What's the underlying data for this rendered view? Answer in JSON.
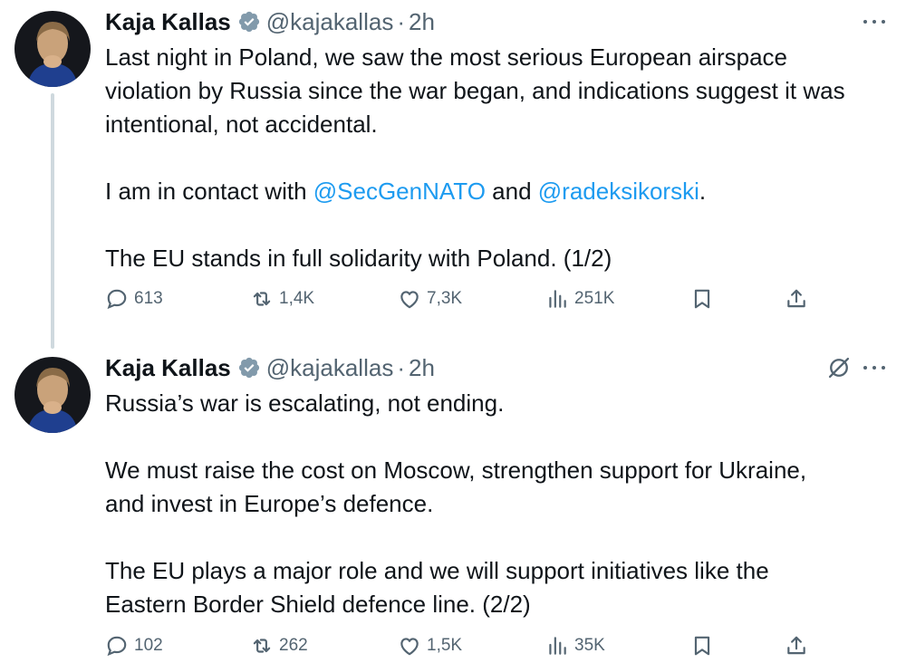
{
  "tweets": [
    {
      "author": {
        "name": "Kaja Kallas",
        "handle": "@kajakallas",
        "time": "2h",
        "verified": true
      },
      "paragraphs": [
        [
          {
            "text": "Last night in Poland, we saw the most serious European airspace"
          },
          {
            "text": "violation by Russia since the war began, and indications suggest it was"
          },
          {
            "text": "intentional, not accidental."
          }
        ],
        [
          {
            "prefix": "I am in contact with ",
            "mention1": "@SecGenNATO",
            "middle": " and ",
            "mention2": "@radeksikorski",
            "suffix": "."
          }
        ],
        [
          {
            "text": "The EU stands in full solidarity with Poland. (1/2)"
          }
        ]
      ],
      "stats": {
        "replies": "613",
        "reposts": "1,4K",
        "likes": "7,3K",
        "views": "251K"
      }
    },
    {
      "author": {
        "name": "Kaja Kallas",
        "handle": "@kajakallas",
        "time": "2h",
        "verified": true
      },
      "paragraphs": [
        [
          {
            "text": "Russia’s war is escalating, not ending."
          }
        ],
        [
          {
            "text": "We must raise the cost on Moscow, strengthen support for Ukraine,"
          },
          {
            "text": "and invest in Europe’s defence."
          }
        ],
        [
          {
            "text": "The EU plays a major role and we will support initiatives like the"
          },
          {
            "text": "Eastern Border Shield defence line. (2/2)"
          }
        ]
      ],
      "stats": {
        "replies": "102",
        "reposts": "262",
        "likes": "1,5K",
        "views": "35K"
      }
    }
  ],
  "separator": "·",
  "colors": {
    "text": "#0f1419",
    "secondary": "#536471",
    "link": "#1d9bf0",
    "verified": "#829aab",
    "thread_line": "#cfd9de"
  },
  "icons": [
    "verified-badge-icon",
    "more-icon",
    "grok-icon",
    "reply-icon",
    "repost-icon",
    "like-icon",
    "views-icon",
    "bookmark-icon",
    "share-icon"
  ]
}
